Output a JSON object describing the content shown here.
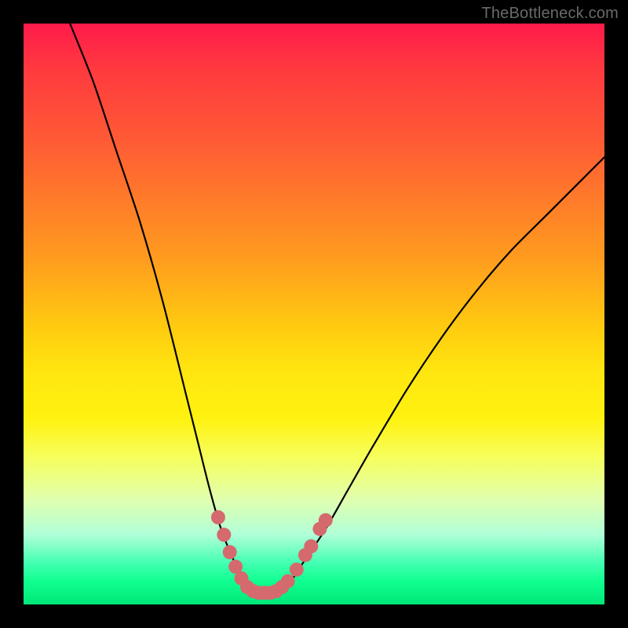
{
  "watermark": "TheBottleneck.com",
  "colors": {
    "curve_stroke": "#000000",
    "marker_fill": "#d56a6e",
    "background": "#000000"
  },
  "chart_data": {
    "type": "line",
    "title": "",
    "xlabel": "",
    "ylabel": "",
    "xlim": [
      0,
      100
    ],
    "ylim": [
      0,
      100
    ],
    "series": [
      {
        "name": "bottleneck-curve",
        "x": [
          8,
          12,
          16,
          20,
          24,
          28,
          30,
          32,
          34,
          36,
          38,
          39,
          40,
          41,
          42,
          43,
          44,
          46,
          48,
          52,
          56,
          60,
          66,
          72,
          78,
          84,
          90,
          96,
          100
        ],
        "y": [
          100,
          90,
          78,
          66,
          52,
          36,
          28,
          20,
          13,
          8,
          4,
          2.5,
          2,
          2,
          2,
          2,
          2.5,
          4,
          7,
          13,
          20,
          27,
          37,
          46,
          54,
          61,
          67,
          73,
          77
        ]
      }
    ],
    "markers": [
      {
        "x": 33.5,
        "y": 15
      },
      {
        "x": 34.5,
        "y": 12
      },
      {
        "x": 35.5,
        "y": 9
      },
      {
        "x": 36.5,
        "y": 6.5
      },
      {
        "x": 37.5,
        "y": 4.5
      },
      {
        "x": 38.5,
        "y": 3
      },
      {
        "x": 39.5,
        "y": 2.3
      },
      {
        "x": 40.5,
        "y": 2
      },
      {
        "x": 41.5,
        "y": 2
      },
      {
        "x": 42.5,
        "y": 2
      },
      {
        "x": 43.5,
        "y": 2.3
      },
      {
        "x": 44.5,
        "y": 3
      },
      {
        "x": 45.5,
        "y": 4
      },
      {
        "x": 47,
        "y": 6
      },
      {
        "x": 48.5,
        "y": 8.5
      },
      {
        "x": 49.5,
        "y": 10
      },
      {
        "x": 51,
        "y": 13
      },
      {
        "x": 52,
        "y": 14.5
      }
    ]
  }
}
